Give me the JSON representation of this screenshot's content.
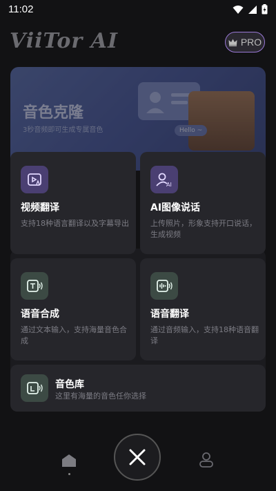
{
  "status": {
    "time": "11:02"
  },
  "header": {
    "brand": "ViiTor AI",
    "pro_label": "PRO"
  },
  "banner": {
    "title": "音色克隆",
    "subtitle": "3秒音频即可生成专属音色",
    "bubble_text": "Hello ~"
  },
  "cards": [
    {
      "title": "视频翻译",
      "desc": "支持18种语言翻译以及字幕导出",
      "icon": "video-translate-icon"
    },
    {
      "title": "AI图像说话",
      "desc": "上传照片，形象支持开口说话，生成视频",
      "icon": "ai-avatar-icon"
    },
    {
      "title": "语音合成",
      "desc": "通过文本输入，支持海量音色合成",
      "icon": "text-to-speech-icon"
    },
    {
      "title": "语音翻译",
      "desc": "通过音频输入，支持18种语音翻译",
      "icon": "voice-translate-icon"
    },
    {
      "title": "音色库",
      "desc": "这里有海量的音色任你选择",
      "icon": "voice-library-icon"
    }
  ],
  "colors": {
    "accent": "#9b7ad8",
    "card_bg": "#26262b",
    "background": "#121214"
  }
}
